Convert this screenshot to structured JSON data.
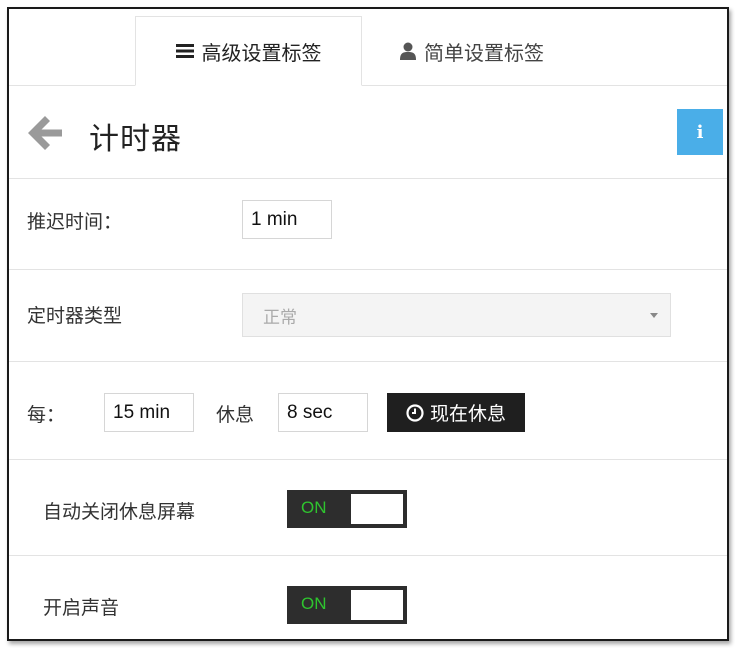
{
  "tabs": [
    {
      "label": "高级设置标签",
      "icon": "menu-icon",
      "active": true
    },
    {
      "label": "简单设置标签",
      "icon": "user-icon",
      "active": false
    }
  ],
  "header": {
    "title": "计时器",
    "info_label": "i"
  },
  "delay": {
    "label": "推迟时间：",
    "value": "1 min"
  },
  "timer_type": {
    "label": "定时器类型",
    "value": "正常"
  },
  "interval": {
    "every_label": "每：",
    "every_value": "15 min",
    "rest_label": "休息",
    "rest_value": "8 sec",
    "rest_now_label": "现在休息"
  },
  "auto_close": {
    "label": "自动关闭休息屏幕",
    "toggle": "ON"
  },
  "sound": {
    "label": "开启声音",
    "toggle": "ON"
  },
  "colors": {
    "accent": "#4aaee8",
    "toggle_on_text": "#2ec42e",
    "dark": "#1f1f1f"
  }
}
